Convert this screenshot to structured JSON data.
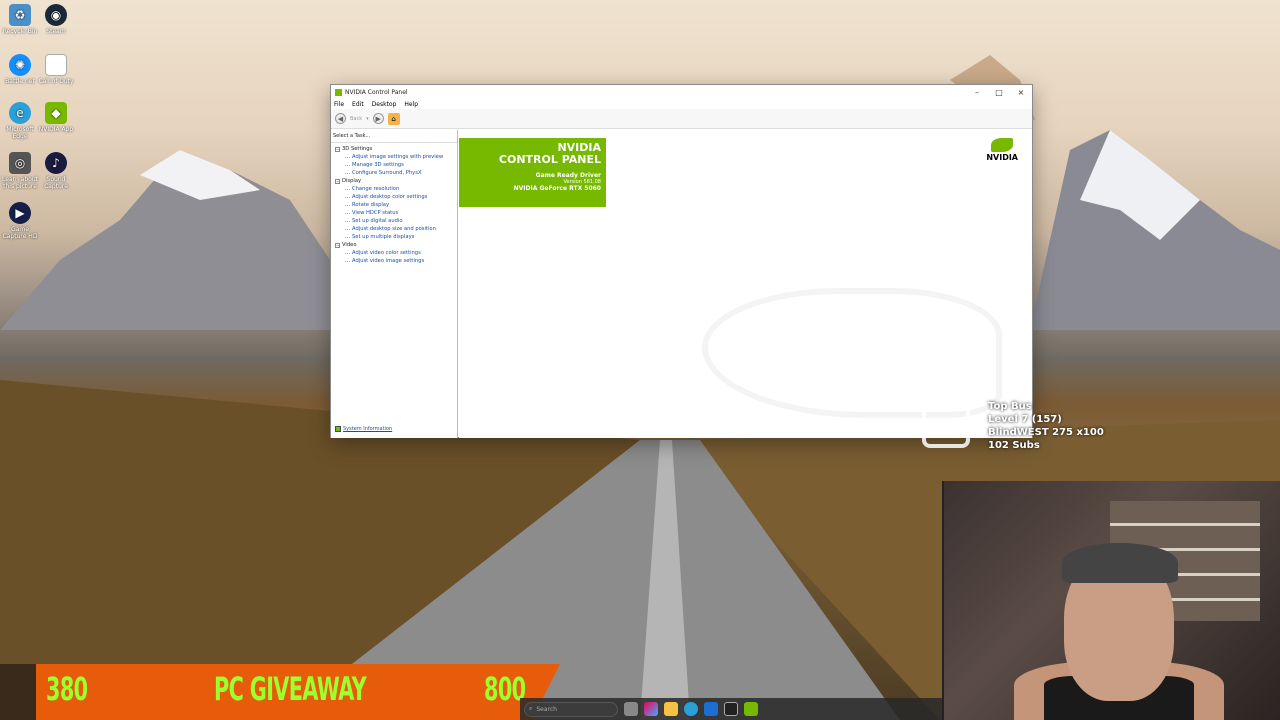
{
  "desktop": {
    "icons": [
      {
        "label": "Recycle Bin",
        "icon": "recycle-bin-icon",
        "color": "#4a90c8"
      },
      {
        "label": "Steam",
        "icon": "steam-icon",
        "color": "#1b2838"
      },
      {
        "label": "Battle.net",
        "icon": "battlenet-icon",
        "color": "#148eff"
      },
      {
        "label": "Call of Duty",
        "icon": "file-icon",
        "color": "#ffffff"
      },
      {
        "label": "Microsoft Edge",
        "icon": "edge-icon",
        "color": "#2aa0d8"
      },
      {
        "label": "NVIDIA App",
        "icon": "nvidia-app-icon",
        "color": "#76b900"
      },
      {
        "label": "Learn about this picture",
        "icon": "camera-icon",
        "color": "#555555"
      },
      {
        "label": "Sound Capture",
        "icon": "audio-icon",
        "color": "#1a1a40"
      },
      {
        "label": "Game Capture HD",
        "icon": "capture-icon",
        "color": "#14204a"
      }
    ]
  },
  "window": {
    "title": "NVIDIA Control Panel",
    "controls": {
      "minimize": "–",
      "maximize": "□",
      "close": "×"
    },
    "menu": [
      "File",
      "Edit",
      "Desktop",
      "Help"
    ],
    "toolbar": {
      "back_label": "Back"
    },
    "left_panel": {
      "header": "Select a Task...",
      "categories": [
        {
          "label": "3D Settings",
          "tasks": [
            "Adjust image settings with preview",
            "Manage 3D settings",
            "Configure Surround, PhysX"
          ]
        },
        {
          "label": "Display",
          "tasks": [
            "Change resolution",
            "Adjust desktop color settings",
            "Rotate display",
            "View HDCP status",
            "Set up digital audio",
            "Adjust desktop size and position",
            "Set up multiple displays"
          ]
        },
        {
          "label": "Video",
          "tasks": [
            "Adjust video color settings",
            "Adjust video image settings"
          ]
        }
      ],
      "system_info": "System Information"
    },
    "banner": {
      "line1": "NVIDIA",
      "line2": "CONTROL PANEL",
      "driver": "Game Ready Driver",
      "version": "Version 581.08",
      "gpu": "NVIDIA GeForce RTX 5060"
    },
    "logo_text": "NVIDIA"
  },
  "overlay": {
    "bus_lines": [
      "Top Bus",
      "Level 7 (157)",
      "BlindWEST 275 x100",
      "102 Subs"
    ],
    "giveaway": {
      "left": "380",
      "center": "PC GIVEAWAY",
      "right": "800"
    }
  },
  "taskbar": {
    "search_placeholder": "Search"
  },
  "colors": {
    "nvidia_green": "#76b900",
    "giveaway_orange": "#e65c0a",
    "giveaway_text": "#9cff2e"
  }
}
